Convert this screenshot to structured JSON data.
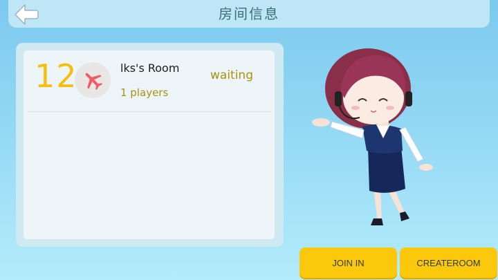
{
  "header": {
    "title": "房间信息",
    "back_icon": "back-arrow-icon"
  },
  "rooms": [
    {
      "number": "12",
      "icon": "airplane-icon",
      "name": "lks's Room",
      "players": "1 players",
      "status": "waiting"
    }
  ],
  "buttons": {
    "join": "JOIN IN",
    "create": "CREATEROOM"
  },
  "colors": {
    "accent_yellow": "#fcc80b",
    "status_olive": "#a7920f",
    "icon_red": "#ee5c66"
  }
}
